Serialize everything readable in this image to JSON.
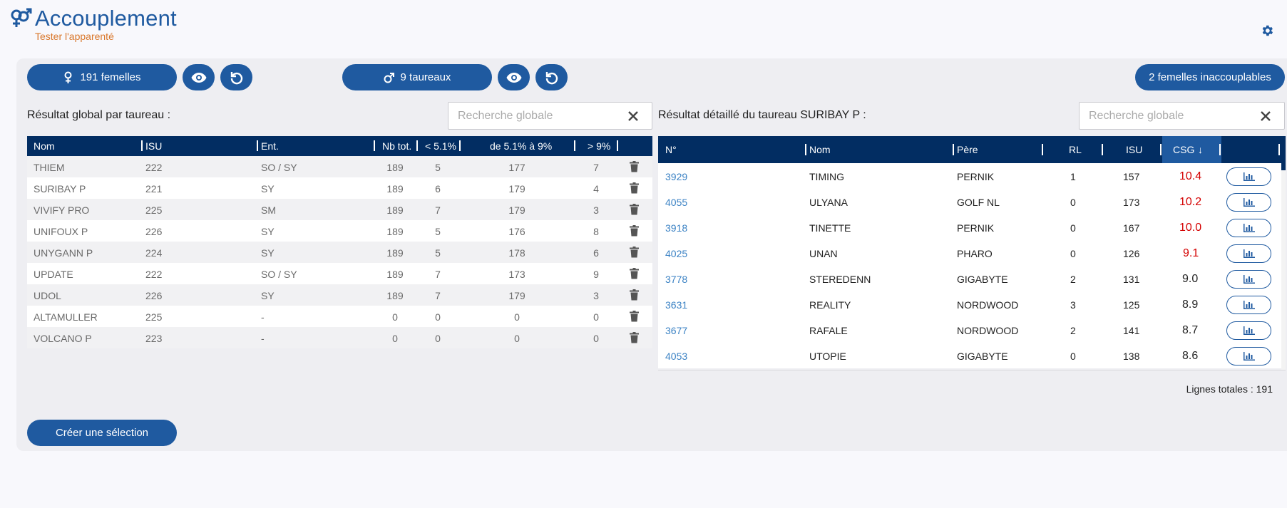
{
  "header": {
    "title": "Accouplement",
    "subtitle": "Tester l'apparenté",
    "title_color": "#1f5aa0",
    "subtitle_color": "#d9772b"
  },
  "toolbar": {
    "females_label": "191 femelles",
    "bulls_label": "9 taureaux",
    "unmatchable_label": "2 femelles inaccouplables",
    "button_color": "#1f5aa0"
  },
  "left": {
    "section_title": "Résultat global par taureau :",
    "search_placeholder": "Recherche globale",
    "columns": [
      "Nom",
      "ISU",
      "Ent.",
      "Nb tot.",
      "< 5.1%",
      "de 5.1% à 9%",
      "> 9%"
    ],
    "rows": [
      {
        "nom": "THIEM",
        "isu": "222",
        "ent": "SO / SY",
        "nb": "189",
        "lt5": "5",
        "mid": "177",
        "gt9": "7"
      },
      {
        "nom": "SURIBAY P",
        "isu": "221",
        "ent": "SY",
        "nb": "189",
        "lt5": "6",
        "mid": "179",
        "gt9": "4"
      },
      {
        "nom": "VIVIFY PRO",
        "isu": "225",
        "ent": "SM",
        "nb": "189",
        "lt5": "7",
        "mid": "179",
        "gt9": "3"
      },
      {
        "nom": "UNIFOUX P",
        "isu": "226",
        "ent": "SY",
        "nb": "189",
        "lt5": "5",
        "mid": "176",
        "gt9": "8"
      },
      {
        "nom": "UNYGANN P",
        "isu": "224",
        "ent": "SY",
        "nb": "189",
        "lt5": "5",
        "mid": "178",
        "gt9": "6"
      },
      {
        "nom": "UPDATE",
        "isu": "222",
        "ent": "SO / SY",
        "nb": "189",
        "lt5": "7",
        "mid": "173",
        "gt9": "9"
      },
      {
        "nom": "UDOL",
        "isu": "226",
        "ent": "SY",
        "nb": "189",
        "lt5": "7",
        "mid": "179",
        "gt9": "3"
      },
      {
        "nom": "ALTAMULLER",
        "isu": "225",
        "ent": "-",
        "nb": "0",
        "lt5": "0",
        "mid": "0",
        "gt9": "0"
      },
      {
        "nom": "VOLCANO P",
        "isu": "223",
        "ent": "-",
        "nb": "0",
        "lt5": "0",
        "mid": "0",
        "gt9": "0"
      }
    ]
  },
  "right": {
    "section_title": "Résultat détaillé du taureau SURIBAY P :",
    "search_placeholder": "Recherche globale",
    "columns": [
      "N°",
      "Nom",
      "Père",
      "RL",
      "ISU",
      "CSG"
    ],
    "sort_indicator": "↓",
    "rows": [
      {
        "num": "3929",
        "nom": "TIMING",
        "pere": "PERNIK",
        "rl": "1",
        "isu": "157",
        "csg": "10.4",
        "highlight": true
      },
      {
        "num": "4055",
        "nom": "ULYANA",
        "pere": "GOLF NL",
        "rl": "0",
        "isu": "173",
        "csg": "10.2",
        "highlight": true
      },
      {
        "num": "3918",
        "nom": "TINETTE",
        "pere": "PERNIK",
        "rl": "0",
        "isu": "167",
        "csg": "10.0",
        "highlight": true
      },
      {
        "num": "4025",
        "nom": "UNAN",
        "pere": "PHARO",
        "rl": "0",
        "isu": "126",
        "csg": "9.1",
        "highlight": true
      },
      {
        "num": "3778",
        "nom": "STEREDENN",
        "pere": "GIGABYTE",
        "rl": "2",
        "isu": "131",
        "csg": "9.0",
        "highlight": false
      },
      {
        "num": "3631",
        "nom": "REALITY",
        "pere": "NORDWOOD",
        "rl": "3",
        "isu": "125",
        "csg": "8.9",
        "highlight": false
      },
      {
        "num": "3677",
        "nom": "RAFALE",
        "pere": "NORDWOOD",
        "rl": "2",
        "isu": "141",
        "csg": "8.7",
        "highlight": false
      },
      {
        "num": "4053",
        "nom": "UTOPIE",
        "pere": "GIGABYTE",
        "rl": "0",
        "isu": "138",
        "csg": "8.6",
        "highlight": false
      }
    ],
    "total_lines": "Lignes totales : 191"
  },
  "footer": {
    "create_selection_label": "Créer une sélection"
  }
}
